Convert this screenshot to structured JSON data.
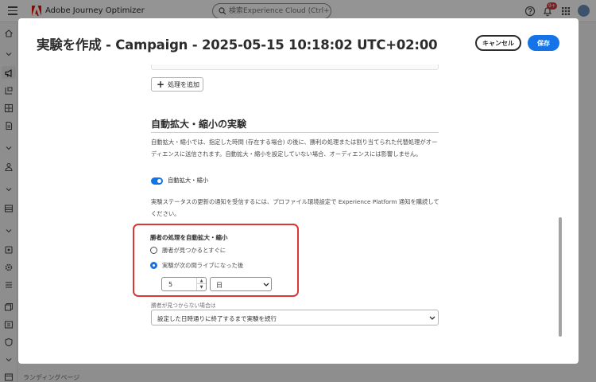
{
  "app": {
    "name": "Adobe Journey Optimizer",
    "search_placeholder": "検索Experience Cloud (Ctrl+/)",
    "notification_count": "9+",
    "bottom_nav_label": "ランディングページ"
  },
  "modal": {
    "title": "実験を作成 - Campaign - 2025-05-15 10:18:02 UTC+02:00",
    "cancel_label": "キャンセル",
    "save_label": "保存",
    "add_treatment_label": "処理を追加",
    "section_title": "自動拡大・縮小の実験",
    "description": "自動拡大・縮小では、指定した時間 (存在する場合) の後に、勝利の処理または割り当てられた代替処理がオーディエンスに送信されます。自動拡大・縮小を設定していない場合、オーディエンスには影響しません。",
    "toggle_label": "自動拡大・縮小",
    "toggle_on": true,
    "notify_text": "実験ステータスの更新の通知を受信するには、プロファイル環境設定で Experience Platform 通知を購読してください。",
    "winner": {
      "heading": "勝者の処理を自動拡大・縮小",
      "option_immediate": "勝者が見つかるとすぐに",
      "option_after": "実験が次の間ライブになった後",
      "selected": "after",
      "duration_value": "5",
      "duration_unit": "日"
    },
    "no_winner": {
      "label": "勝者が見つからない場合は",
      "value": "設定した日時通りに終了するまで実験を続行"
    }
  },
  "colors": {
    "accent": "#1473e6",
    "highlight_box": "#d93636",
    "adobe_red": "#eb1000"
  }
}
